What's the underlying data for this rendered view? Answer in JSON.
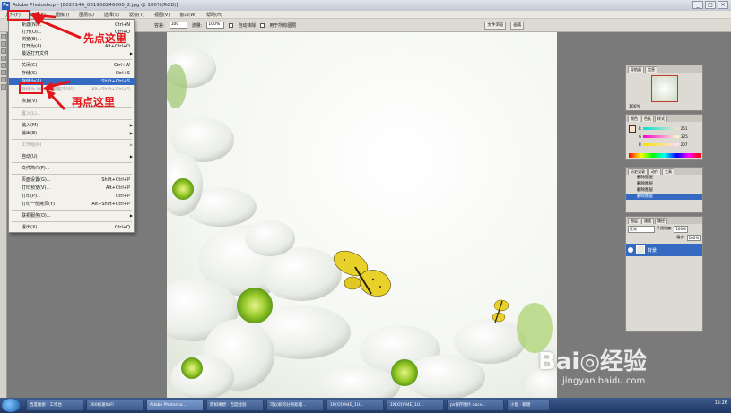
{
  "window": {
    "title": "Adobe Photoshop - [8029146_081958246000_2.jpg @ 100%(RGB)]",
    "buttons": [
      "_",
      "□",
      "×"
    ]
  },
  "menubar": [
    "文件(F)",
    "编辑(E)",
    "图像(I)",
    "图层(L)",
    "选择(S)",
    "滤镜(T)",
    "视图(V)",
    "窗口(W)",
    "帮助(H)"
  ],
  "options": {
    "tolerance_label": "容差:",
    "tolerance_value": "100",
    "flow_label": "流量:",
    "flow_value": "100%",
    "auto_erase": "自动抹除",
    "all_layers": "用于所有图层",
    "tab1": "文件浏览",
    "tab2": "画笔"
  },
  "file_menu": {
    "items": [
      {
        "label": "新建(N)...",
        "shortcut": "Ctrl+N",
        "state": "normal"
      },
      {
        "label": "打开(O)...",
        "shortcut": "Ctrl+O",
        "state": "normal"
      },
      {
        "label": "浏览(B)...",
        "shortcut": "",
        "state": "normal"
      },
      {
        "label": "打开为(A)...",
        "shortcut": "Alt+Ctrl+O",
        "state": "normal"
      },
      {
        "label": "最近打开文件",
        "shortcut": "",
        "state": "normal",
        "submenu": true
      },
      {
        "label": "关闭(C)",
        "shortcut": "Ctrl+W",
        "state": "normal"
      },
      {
        "label": "存储(S)",
        "shortcut": "Ctrl+S",
        "state": "normal"
      },
      {
        "label": "存储为(A)...",
        "shortcut": "Shift+Ctrl+S",
        "state": "selected"
      },
      {
        "label": "存储为 Web 所用格式(W)...",
        "shortcut": "Alt+Shift+Ctrl+S",
        "state": "disabled"
      },
      {
        "label": "恢复(V)",
        "shortcut": "",
        "state": "normal"
      },
      {
        "label": "置入(L)...",
        "shortcut": "",
        "state": "disabled"
      },
      {
        "label": "输入(M)",
        "shortcut": "",
        "state": "normal",
        "submenu": true
      },
      {
        "label": "输出(E)",
        "shortcut": "",
        "state": "normal",
        "submenu": true
      },
      {
        "label": "工作组(K)",
        "shortcut": "",
        "state": "disabled",
        "submenu": true
      },
      {
        "label": "自动(U)",
        "shortcut": "",
        "state": "normal",
        "submenu": true
      },
      {
        "label": "文件简介(F)...",
        "shortcut": "",
        "state": "normal"
      },
      {
        "label": "页面设置(G)...",
        "shortcut": "Shift+Ctrl+P",
        "state": "normal"
      },
      {
        "label": "打印预览(V)...",
        "shortcut": "Alt+Ctrl+P",
        "state": "normal"
      },
      {
        "label": "打印(P)...",
        "shortcut": "Ctrl+P",
        "state": "normal"
      },
      {
        "label": "打印一份拷贝(Y)",
        "shortcut": "Alt+Shift+Ctrl+P",
        "state": "normal"
      },
      {
        "label": "联机服务(O)...",
        "shortcut": "",
        "state": "normal",
        "submenu": true
      },
      {
        "label": "退出(X)",
        "shortcut": "Ctrl+Q",
        "state": "normal"
      }
    ]
  },
  "annotations": {
    "first": "先点这里",
    "second": "再点这里"
  },
  "panels": {
    "navigator": {
      "tabs": [
        "导航器",
        "信息"
      ],
      "zoom": "100%"
    },
    "color": {
      "tabs": [
        "颜色",
        "色板",
        "样式"
      ],
      "r": "251",
      "g": "225",
      "b": "207",
      "r_label": "R",
      "g_label": "G",
      "b_label": "B"
    },
    "history": {
      "tabs": [
        "历史记录",
        "动作",
        "工具"
      ],
      "items": [
        "删除图层",
        "删除图层",
        "删除图层",
        "删除图层"
      ]
    },
    "layers": {
      "tabs": [
        "图层",
        "通道",
        "路径"
      ],
      "mode": "正常",
      "opacity_label": "不透明度:",
      "opacity": "100%",
      "fill_label": "填充:",
      "fill": "100%",
      "layer_name": "背景"
    }
  },
  "taskbar": {
    "items": [
      "百度搜索 - 工作台",
      "360极速WiFi",
      "Adobe Photosho...",
      "而如果想 - 百度经验",
      "可以如何分别处理...",
      "1N[O]Y94E_1U...",
      "1N[O]Y94E_1U...",
      "ps保存图片.docx...",
      "小窗 · 新增"
    ],
    "active_index": 2,
    "clock": "15:26"
  },
  "watermark": {
    "main": "Bai◎经验",
    "sub": "jingyan.baidu.com"
  },
  "nav": {
    "prev": "‹",
    "next": "›"
  }
}
